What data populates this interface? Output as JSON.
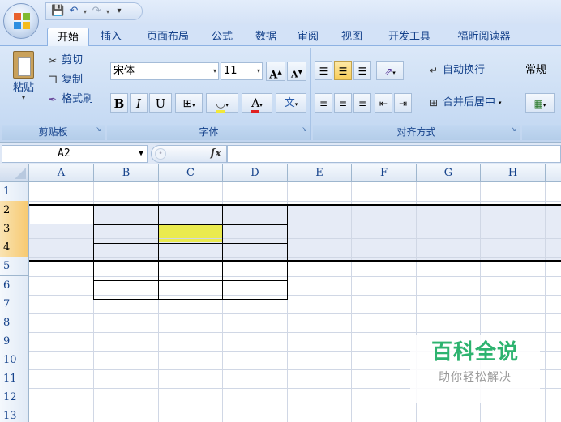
{
  "quick_access": {
    "icons": [
      "save-icon",
      "undo-icon",
      "redo-icon",
      "customize-icon"
    ]
  },
  "tabs": [
    "开始",
    "插入",
    "页面布局",
    "公式",
    "数据",
    "审阅",
    "视图",
    "开发工具",
    "福昕阅读器"
  ],
  "active_tab": "开始",
  "ribbon": {
    "clipboard": {
      "paste": "粘贴",
      "cut": "剪切",
      "copy": "复制",
      "format_painter": "格式刷",
      "label": "剪贴板"
    },
    "font": {
      "font_name": "宋体",
      "font_size": "11",
      "bold": "B",
      "italic": "I",
      "underline": "U",
      "label": "字体"
    },
    "alignment": {
      "wrap_text": "自动换行",
      "merge_center": "合并后居中",
      "label": "对齐方式"
    },
    "number": {
      "format": "常规"
    }
  },
  "formula_bar": {
    "name_box": "A2",
    "fx": "fx",
    "value": ""
  },
  "sheet": {
    "columns": [
      "A",
      "B",
      "C",
      "D",
      "E",
      "F",
      "G",
      "H"
    ],
    "rows": [
      "1",
      "2",
      "3",
      "4",
      "5",
      "6",
      "7",
      "8",
      "9",
      "10",
      "11",
      "12",
      "13"
    ],
    "selected_rows": [
      "2",
      "3",
      "4"
    ],
    "active_cell": "A2",
    "highlighted_cell": "C3",
    "highlight_color": "#eaea4f"
  },
  "watermark": {
    "title": "百科全说",
    "subtitle": "助你轻松解决"
  }
}
